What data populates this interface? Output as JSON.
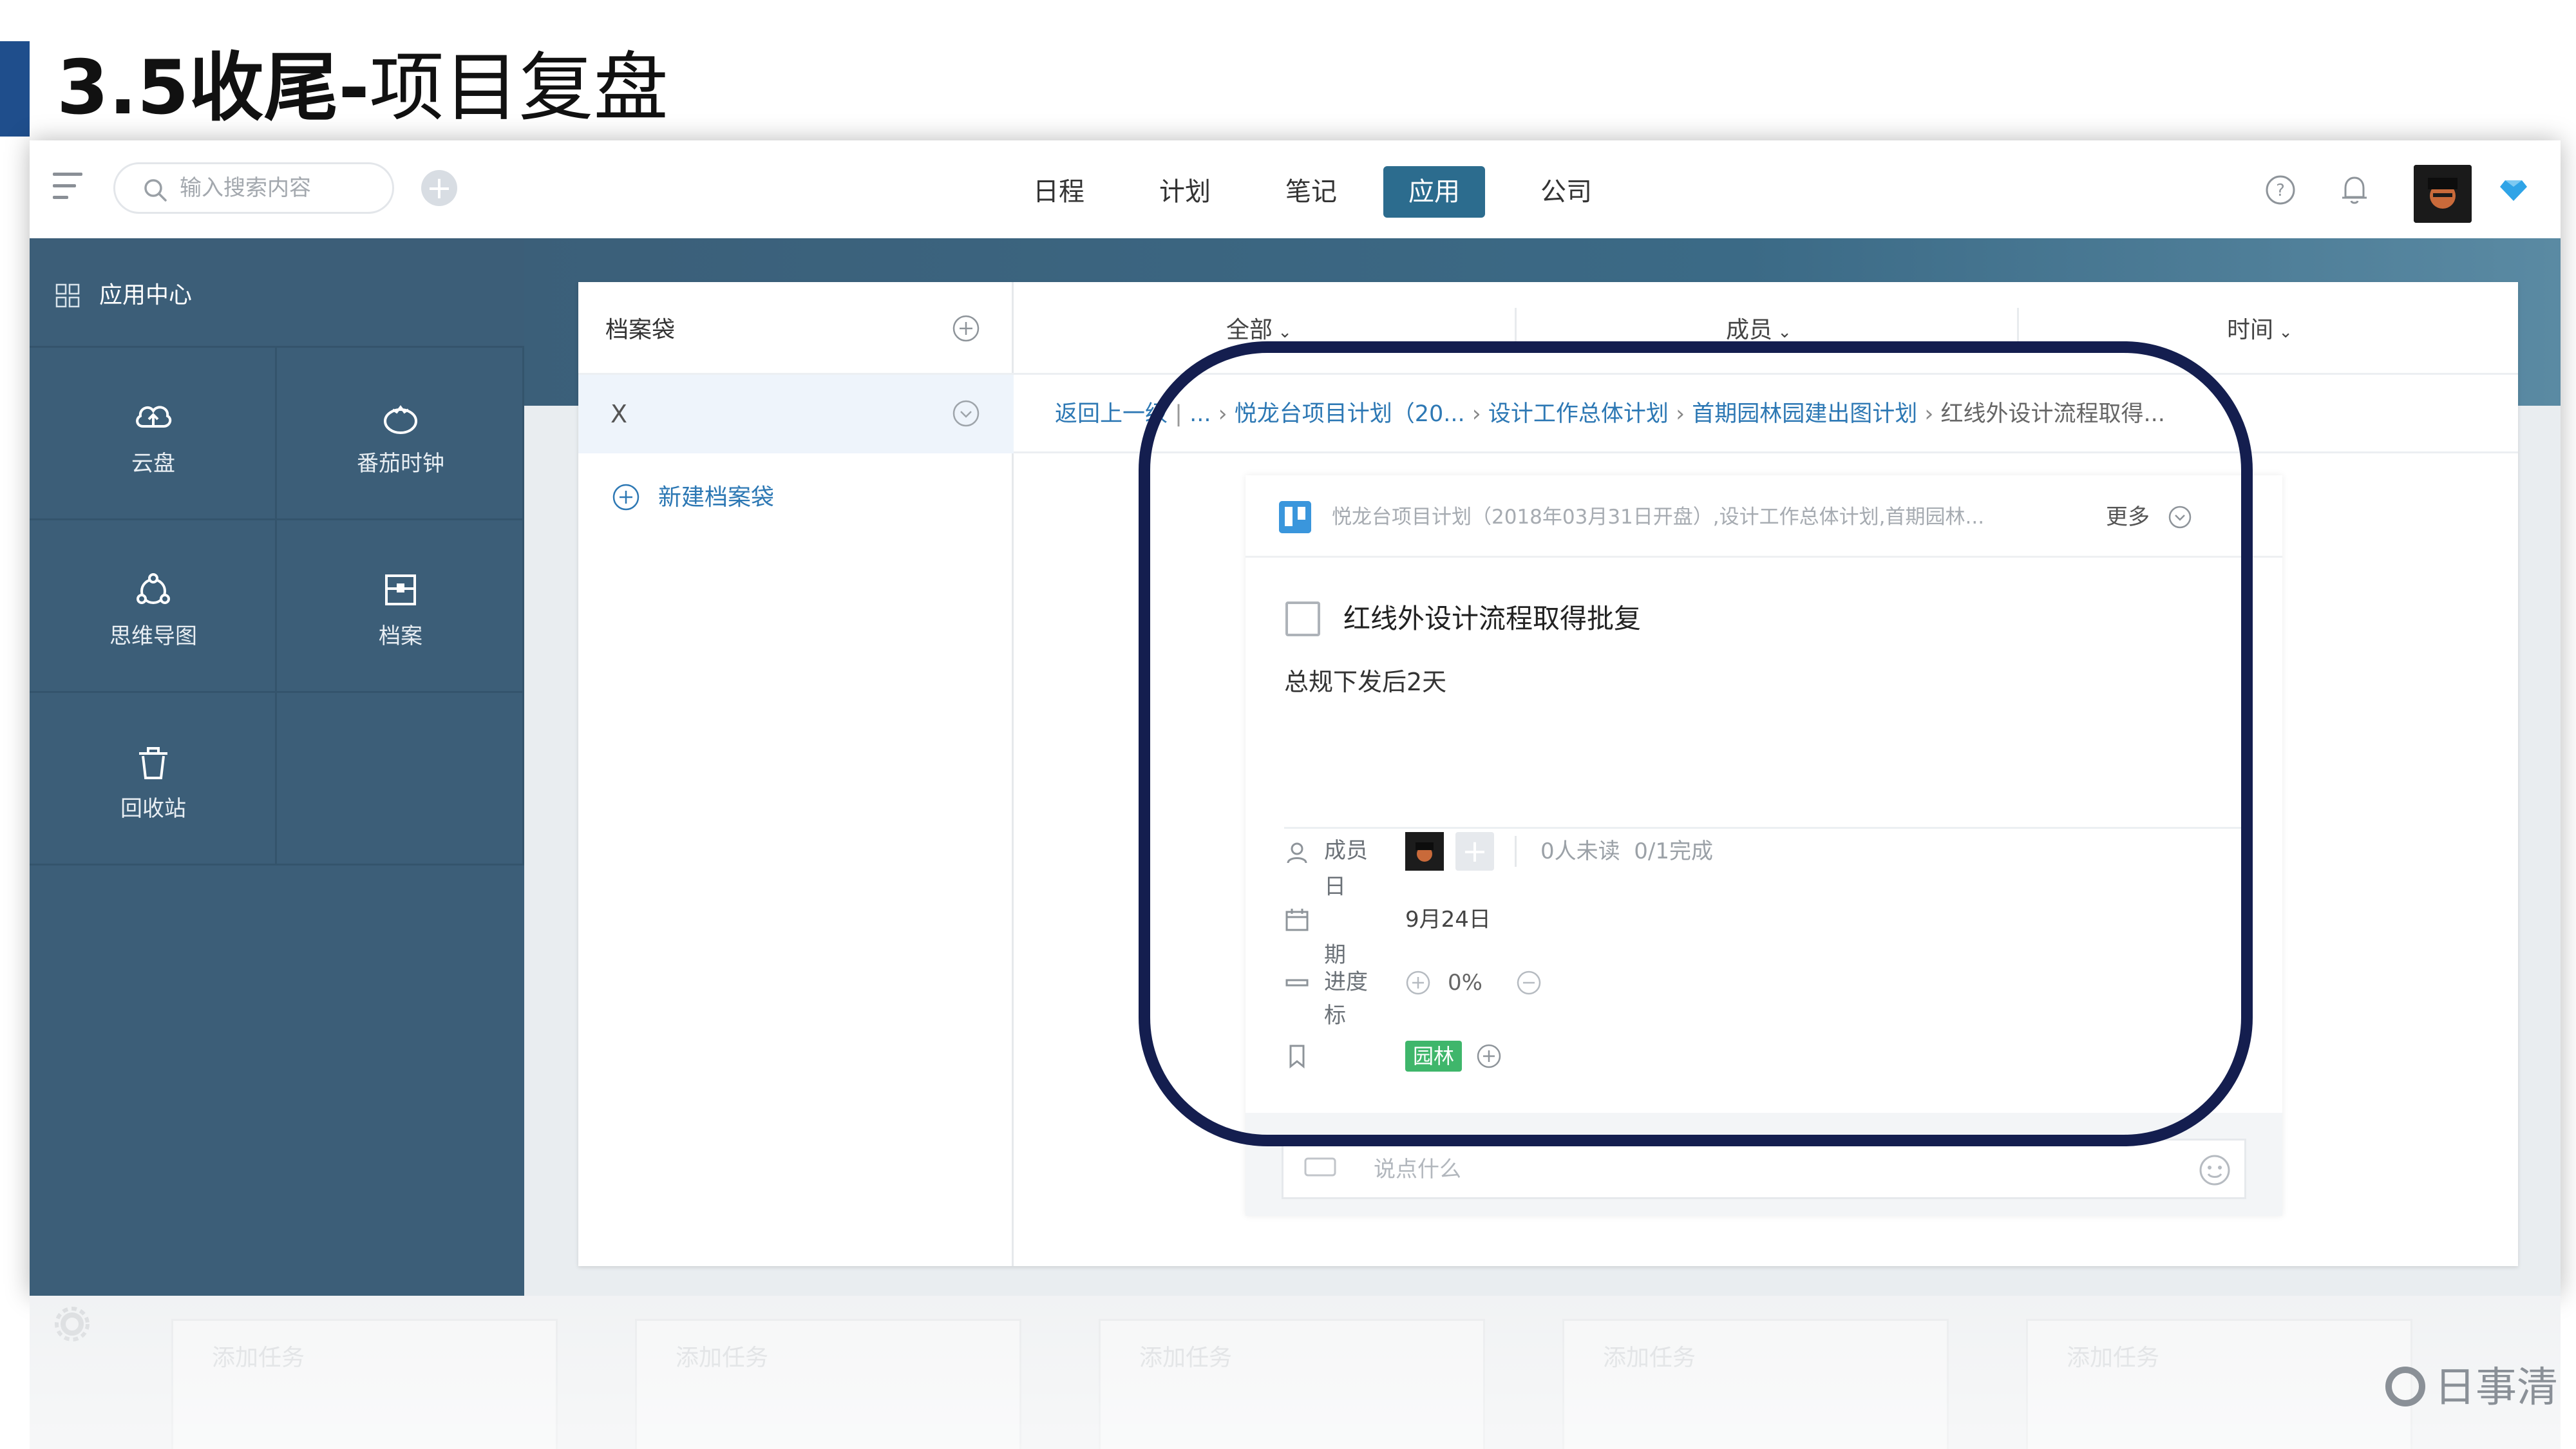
{
  "slide": {
    "title_bold": "3.5收尾-",
    "title_rest": "项目复盘"
  },
  "topbar": {
    "search_placeholder": "输入搜索内容",
    "nav_tabs": [
      "日程",
      "计划",
      "笔记",
      "应用",
      "公司"
    ],
    "active_tab": "应用"
  },
  "sidebar": {
    "title": "应用中心",
    "apps": [
      {
        "label": "云盘",
        "icon": "cloud-upload-icon"
      },
      {
        "label": "番茄时钟",
        "icon": "tomato-clock-icon"
      },
      {
        "label": "思维导图",
        "icon": "mind-map-icon"
      },
      {
        "label": "档案",
        "icon": "archive-icon"
      },
      {
        "label": "回收站",
        "icon": "trash-icon"
      }
    ]
  },
  "folders": {
    "header": "档案袋",
    "items": [
      {
        "label": "X"
      }
    ],
    "new_label": "新建档案袋"
  },
  "filters": {
    "all": "全部",
    "members": "成员",
    "time": "时间"
  },
  "breadcrumb": {
    "back": "返回上一级",
    "parts": [
      "...",
      "悦龙台项目计划（20...",
      "设计工作总体计划",
      "首期园林园建出图计划"
    ],
    "current": "红线外设计流程取得..."
  },
  "task": {
    "path": "悦龙台项目计划（2018年03月31日开盘）,设计工作总体计划,首期园林...",
    "more": "更多",
    "title": "红线外设计流程取得批复",
    "description": "总规下发后2天",
    "members_label_1": "成员",
    "members_label_2": "日",
    "read_status": "0人未读",
    "done_status": "0/1完成",
    "date_label_1": "期",
    "date_value": "9月24日",
    "progress_label": "进度",
    "progress_value": "0%",
    "tag_label": "标",
    "tag": "园林",
    "tag_color": "#3fb66b",
    "comment_placeholder": "说点什么"
  },
  "bottom": {
    "card_label": "添加任务",
    "watermark": "日事清"
  },
  "colors": {
    "sidebar": "#3c5e78",
    "accent": "#2c6c8e",
    "link": "#2d78b4",
    "highlight": "#141e4f",
    "title_bar": "#1f4e8c"
  }
}
